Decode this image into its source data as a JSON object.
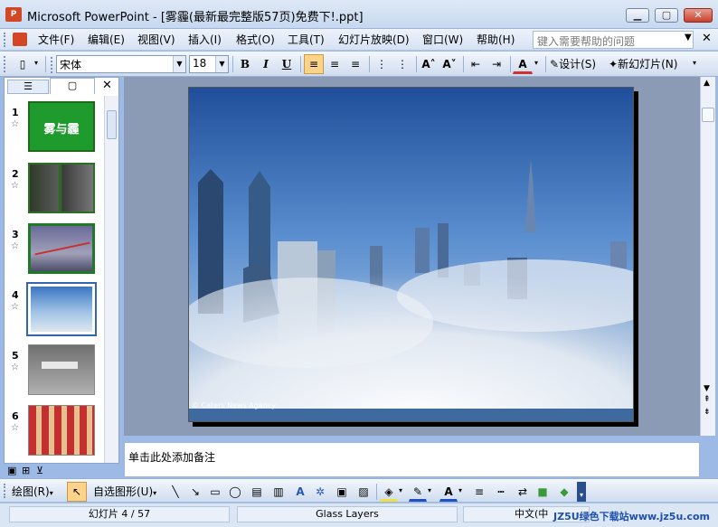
{
  "window": {
    "title": "Microsoft PowerPoint - [雾霾(最新最完整版57页)免费下!.ppt]",
    "app_icon": "P",
    "min": "▁",
    "max": "▢",
    "close": "✕"
  },
  "menu": {
    "items": [
      "文件(F)",
      "编辑(E)",
      "视图(V)",
      "插入(I)",
      "格式(O)",
      "工具(T)",
      "幻灯片放映(D)",
      "窗口(W)",
      "帮助(H)"
    ],
    "help_placeholder": "键入需要帮助的问题"
  },
  "toolbar": {
    "font": "宋体",
    "size": "18",
    "bold": "B",
    "italic": "I",
    "underline": "U",
    "design": "设计(S)",
    "new_slide": "新幻灯片(N)"
  },
  "panel": {
    "tab_outline": "☰",
    "tab_slides": "▢",
    "close": "✕",
    "slides": [
      {
        "num": "1",
        "star": "☆",
        "text": "雾与霾",
        "color": "#1a9a2a"
      },
      {
        "num": "2",
        "star": "☆",
        "text": "",
        "color": "#2c5a1c"
      },
      {
        "num": "3",
        "star": "☆",
        "text": "",
        "color": "#2a7a2a"
      },
      {
        "num": "4",
        "star": "☆",
        "text": "",
        "color": "#3f6fb0"
      },
      {
        "num": "5",
        "star": "☆",
        "text": "",
        "color": "#8a8a8a"
      },
      {
        "num": "6",
        "star": "☆",
        "text": "",
        "color": "#8a4a2a"
      }
    ]
  },
  "slide": {
    "caption": "© Caters News Agency"
  },
  "notes": {
    "placeholder": "单击此处添加备注"
  },
  "drawbar": {
    "draw": "绘图(R)",
    "autoshapes": "自选图形(U)"
  },
  "status": {
    "slide_pos": "幻灯片 4 / 57",
    "template": "Glass Layers",
    "language": "中文(中",
    "watermark": "JZ5U绿色下载站www.jz5u.com"
  },
  "colors": {
    "accent": "#d24726",
    "chrome": "#c6d8ef"
  }
}
